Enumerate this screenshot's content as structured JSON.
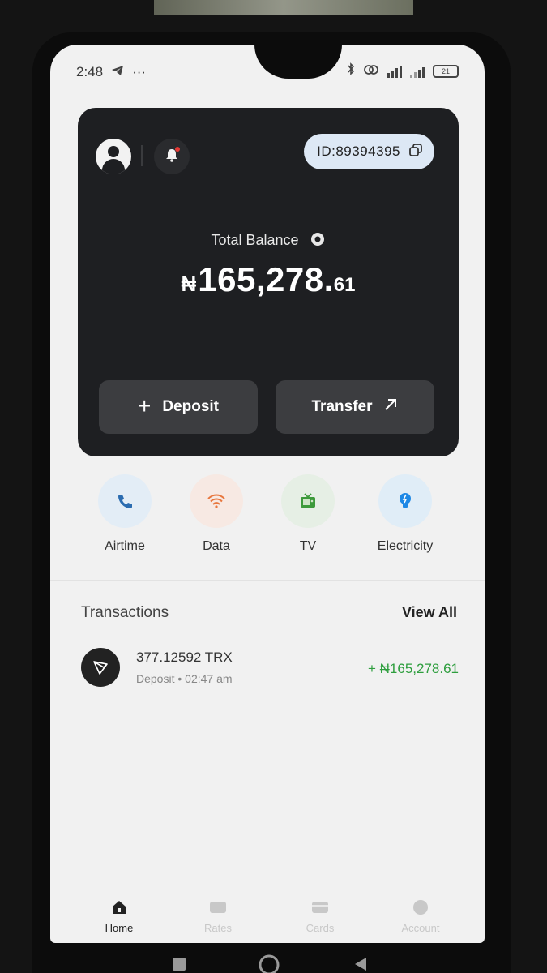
{
  "status_bar": {
    "time": "2:48",
    "battery": "21"
  },
  "header": {
    "user_id": "ID:89394395"
  },
  "balance": {
    "label": "Total Balance",
    "currency": "₦",
    "amount_main": "165,278.",
    "amount_cents": "61"
  },
  "actions": {
    "deposit_label": "Deposit",
    "transfer_label": "Transfer"
  },
  "services": [
    {
      "label": "Airtime",
      "icon": "phone-icon",
      "bg": "#e3edf6",
      "color": "#2b6cb0"
    },
    {
      "label": "Data",
      "icon": "wifi-icon",
      "bg": "#f7e9e3",
      "color": "#e8773e"
    },
    {
      "label": "TV",
      "icon": "tv-icon",
      "bg": "#e6efe5",
      "color": "#3d9a3b"
    },
    {
      "label": "Electricity",
      "icon": "bulb-icon",
      "bg": "#e0edf7",
      "color": "#1e88e5"
    }
  ],
  "transactions": {
    "title": "Transactions",
    "view_all": "View All",
    "items": [
      {
        "name": "377.12592 TRX",
        "type": "Deposit",
        "separator": "•",
        "time": "02:47 am",
        "amount": "+ ₦165,278.61"
      }
    ]
  },
  "nav": {
    "items": [
      {
        "label": "Home",
        "active": true
      },
      {
        "label": "Rates",
        "active": false
      },
      {
        "label": "Cards",
        "active": false
      },
      {
        "label": "Account",
        "active": false
      }
    ]
  }
}
